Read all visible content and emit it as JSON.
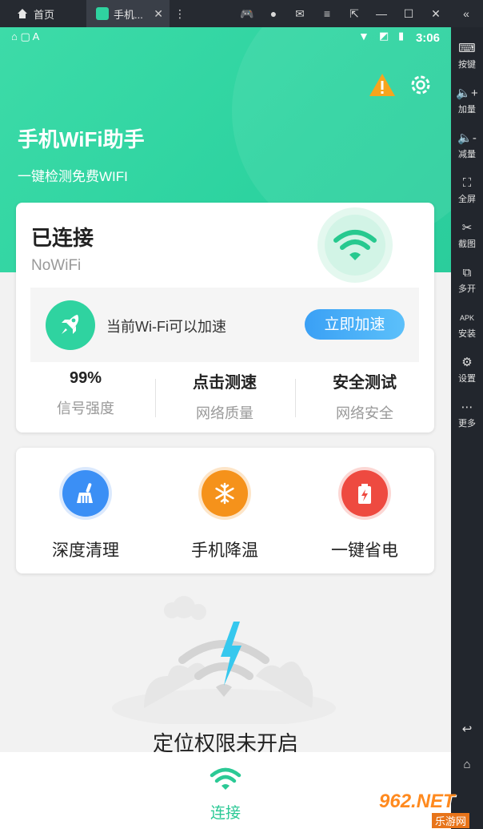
{
  "emulator": {
    "home_tab": "首页",
    "app_tab": "手机...",
    "sidebar": [
      "按键",
      "加量",
      "减量",
      "全屏",
      "截图",
      "多开",
      "安装",
      "设置",
      "更多"
    ]
  },
  "status": {
    "time": "3:06"
  },
  "hero": {
    "title": "手机WiFi助手",
    "subtitle": "一键检测免费WIFI"
  },
  "connection": {
    "status": "已连接",
    "ssid": "NoWiFi",
    "boost_text": "当前Wi-Fi可以加速",
    "boost_button": "立即加速"
  },
  "stats": [
    {
      "value": "99%",
      "label": "信号强度"
    },
    {
      "value": "点击测速",
      "label": "网络质量"
    },
    {
      "value": "安全测试",
      "label": "网络安全"
    }
  ],
  "tools": [
    {
      "label": "深度清理",
      "icon": "broom-icon",
      "color": "#3b8ff5"
    },
    {
      "label": "手机降温",
      "icon": "snowflake-icon",
      "color": "#f5921b"
    },
    {
      "label": "一键省电",
      "icon": "battery-icon",
      "color": "#ee4a40"
    }
  ],
  "location": {
    "title": "定位权限未开启"
  },
  "bottom_nav": {
    "label": "连接"
  },
  "watermark": {
    "text": "962.NET",
    "sub": "乐游网"
  },
  "colors": {
    "accent": "#2fd3a0",
    "button": "#3aa0f5"
  }
}
